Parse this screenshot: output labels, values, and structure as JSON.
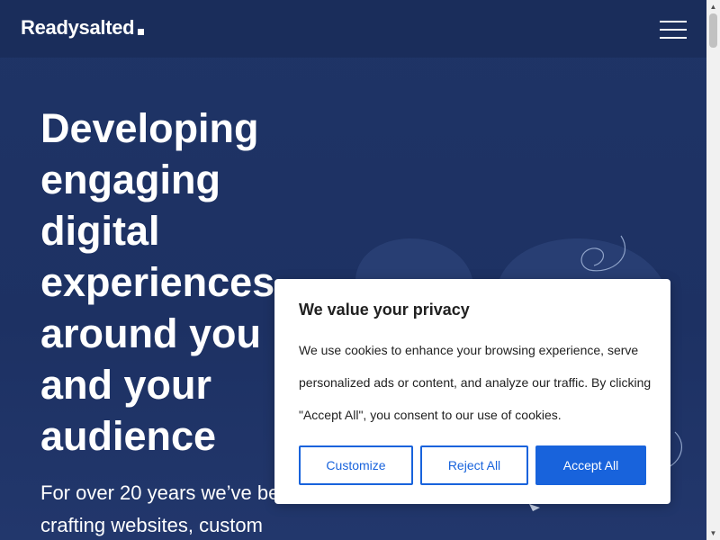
{
  "header": {
    "logo_text": "Readysalted",
    "menu_icon": "hamburger-menu-icon"
  },
  "hero": {
    "title": "Developing engaging digital experiences around you and your audience",
    "subtitle": "For over 20 years we’ve been crafting websites, custom"
  },
  "cookie_banner": {
    "title": "We value your privacy",
    "text": "We use cookies to enhance your browsing experience, serve personalized ads or content, and analyze our traffic. By clicking \"Accept All\", you consent to our use of cookies.",
    "buttons": {
      "customize": "Customize",
      "reject": "Reject All",
      "accept": "Accept All"
    }
  },
  "colors": {
    "background": "#1f3466",
    "header": "#1a2d5b",
    "accent": "#1863dc",
    "text_light": "#ffffff",
    "text_dark": "#212121"
  },
  "scrollbar": {
    "up_icon": "arrow-up-icon",
    "down_icon": "arrow-down-icon"
  }
}
